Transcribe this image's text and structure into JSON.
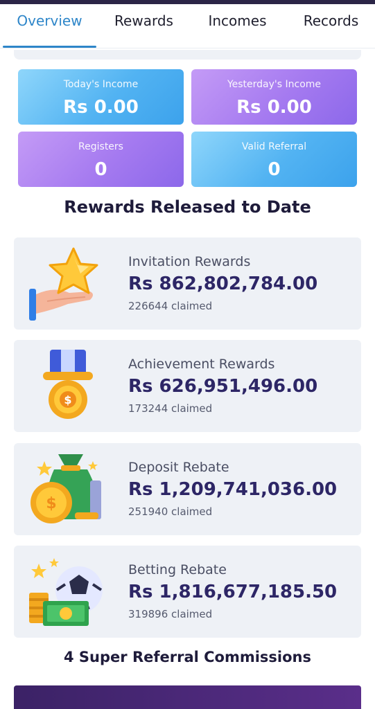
{
  "tabs": [
    {
      "label": "Overview",
      "active": true
    },
    {
      "label": "Rewards",
      "active": false
    },
    {
      "label": "Incomes",
      "active": false
    },
    {
      "label": "Records",
      "active": false
    }
  ],
  "stats": {
    "today": {
      "label": "Today's Income",
      "value": "Rs 0.00"
    },
    "yesterday": {
      "label": "Yesterday's Income",
      "value": "Rs 0.00"
    },
    "registers": {
      "label": "Registers",
      "value": "0"
    },
    "valid_referral": {
      "label": "Valid Referral",
      "value": "0"
    }
  },
  "rewards_title": "Rewards Released to Date",
  "rewards": [
    {
      "name": "Invitation Rewards",
      "amount": "Rs 862,802,784.00",
      "claimed": "226644 claimed",
      "icon": "star-hand-icon"
    },
    {
      "name": "Achievement Rewards",
      "amount": "Rs 626,951,496.00",
      "claimed": "173244 claimed",
      "icon": "medal-icon"
    },
    {
      "name": "Deposit Rebate",
      "amount": "Rs 1,209,741,036.00",
      "claimed": "251940 claimed",
      "icon": "money-bag-icon"
    },
    {
      "name": "Betting Rebate",
      "amount": "Rs 1,816,677,185.50",
      "claimed": "319896 claimed",
      "icon": "soccer-cash-icon"
    }
  ],
  "footer_title": "4 Super Referral Commissions",
  "colors": {
    "accent": "#2e86c9",
    "amount": "#2d2666",
    "card_bg": "#eef1f6",
    "stat_blue": "#52b3f2",
    "stat_purple": "#a57af0"
  }
}
